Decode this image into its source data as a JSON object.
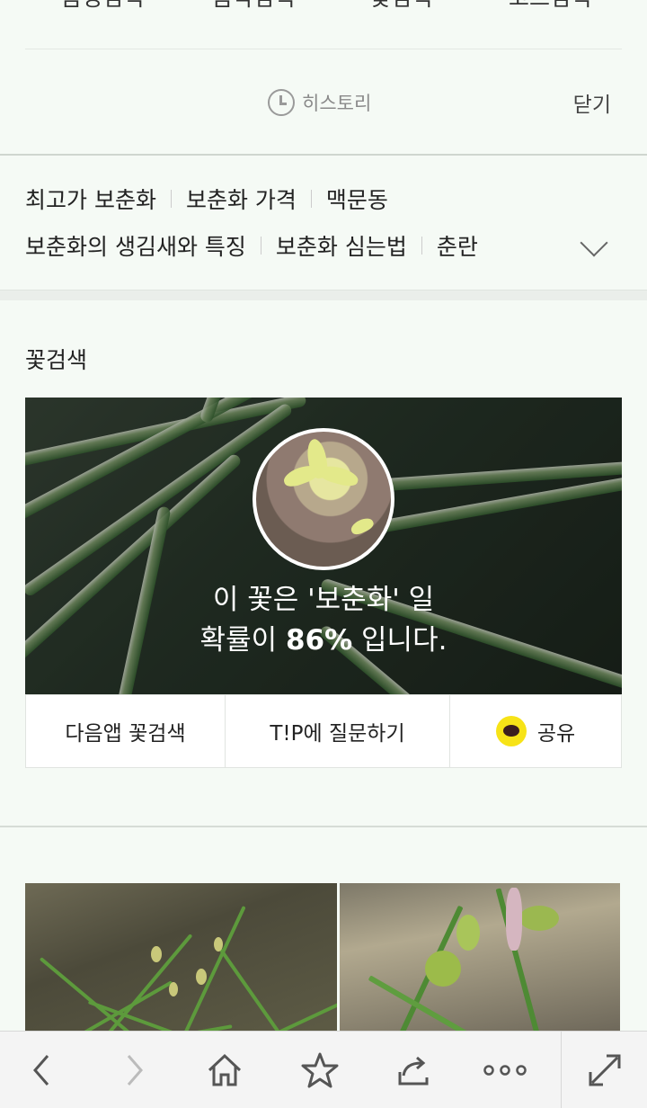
{
  "top_tabs": [
    "음성검색",
    "음악검색",
    "꽃검색",
    "코드검색"
  ],
  "history": {
    "label": "히스토리"
  },
  "close_label": "닫기",
  "related": {
    "line1": [
      "최고가 보춘화",
      "보춘화 가격",
      "맥문동"
    ],
    "line2": [
      "보춘화의 생김새와 특징",
      "보춘화 심는법",
      "춘란"
    ]
  },
  "flower_search": {
    "title": "꽃검색",
    "result_line1": "이 꽃은 '보춘화' 일",
    "result_prefix": "확률이 ",
    "probability": "86%",
    "result_suffix": " 입니다.",
    "actions": [
      "다음앱 꽃검색",
      "T!P에 질문하기",
      "공유"
    ]
  },
  "colors": {
    "kakao_yellow": "#f7e317",
    "background": "#f5faf5"
  },
  "bottom_nav": [
    "back-icon",
    "forward-icon",
    "home-icon",
    "bookmark-star-icon",
    "share-icon",
    "more-icon",
    "expand-icon"
  ]
}
